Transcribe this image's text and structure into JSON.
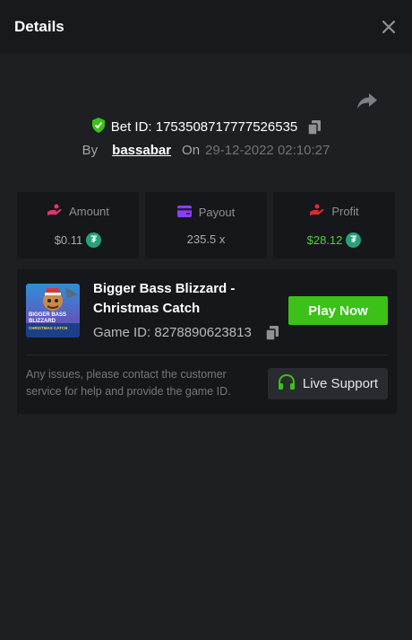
{
  "header": {
    "title": "Details",
    "close_icon": "close-icon"
  },
  "bet": {
    "bet_id_label": "Bet ID: 1753508717777526535",
    "by_label": "By",
    "username": "bassabar",
    "on_label": "On",
    "date": "29-12-2022 02:10:27"
  },
  "stats": {
    "amount": {
      "label": "Amount",
      "value": "$0.11",
      "icon": "amount-hand-icon",
      "color": "#e8336b"
    },
    "payout": {
      "label": "Payout",
      "value": "235.5 x",
      "icon": "wallet-card-icon",
      "color": "#8b3dff"
    },
    "profit": {
      "label": "Profit",
      "value": "$28.12",
      "icon": "profit-hand-icon",
      "color": "#e02a2a"
    }
  },
  "currency": {
    "symbol": "₮",
    "color": "#26a17b"
  },
  "game": {
    "name": "Bigger Bass Blizzard - Christmas Catch",
    "game_id_label": "Game ID: 8278890623813",
    "play_label": "Play Now",
    "thumb_text_top": "BIGGER BASS",
    "thumb_text_mid": "BLIZZARD",
    "thumb_text_bot": "CHRISTMAS CATCH"
  },
  "support": {
    "message": "Any issues, please contact the customer service for help and provide the game ID.",
    "button_label": "Live Support"
  },
  "colors": {
    "accent_green": "#3bc117",
    "profit_green": "#4bd13d",
    "verified_green": "#3bc117"
  }
}
